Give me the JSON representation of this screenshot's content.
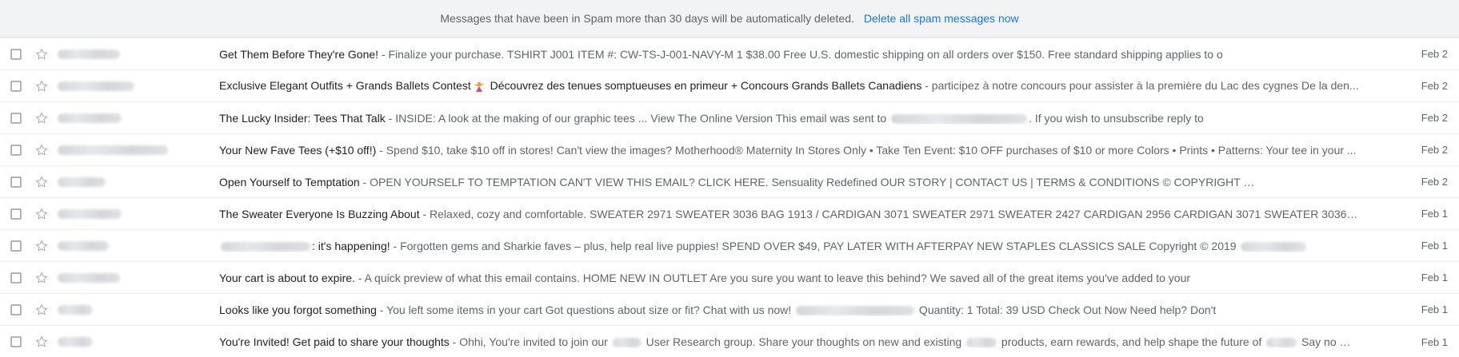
{
  "banner": {
    "message": "Messages that have been in Spam more than 30 days will be automatically deleted.",
    "action": "Delete all spam messages now"
  },
  "emails": [
    {
      "sender_blur_width": 78,
      "subject": "Get Them Before They're Gone!",
      "snippet_parts": [
        " - Finalize your purchase. TSHIRT J001 ITEM #: CW-TS-J-001-NAVY-M 1 $38.00 Free U.S. domestic shipping on all orders over $150. Free standard shipping applies to o"
      ],
      "date": "Feb 2"
    },
    {
      "sender_blur_width": 96,
      "subject": "Exclusive Elegant Outfits + Grands Ballets Contest",
      "emoji": "dancer-emoji",
      "subject_tail": " Découvrez des tenues somptueuses en primeur + Concours Grands Ballets Canadiens",
      "snippet_parts": [
        " - participez à notre concours pour assister à la première du Lac des cygnes De la den..."
      ],
      "date": "Feb 2"
    },
    {
      "sender_blur_width": 80,
      "subject": "The Lucky Insider: Tees That Talk",
      "snippet_parts": [
        " - INSIDE: A look at the making of our graphic tees ... View The Online Version This email was sent to ",
        "",
        ". If you wish to unsubscribe reply to"
      ],
      "snippet_blur_widths": [
        170
      ],
      "date": "Feb 2"
    },
    {
      "sender_blur_width": 138,
      "subject": "Your New Fave Tees (+$10 off!)",
      "snippet_parts": [
        " - Spend $10, take $10 off in stores! Can't view the images? Motherhood® Maternity In Stores Only • Take Ten Event: $10 OFF purchases of $10 or more Colors • Prints • Patterns: Your tee in your ..."
      ],
      "date": "Feb 2"
    },
    {
      "sender_blur_width": 60,
      "subject": "Open Yourself to Temptation",
      "snippet_parts": [
        " - OPEN YOURSELF TO TEMPTATION CAN'T VIEW THIS EMAIL? CLICK HERE. Sensuality Redefined OUR STORY | CONTACT US | TERMS & CONDITIONS © COPYRIGHT ",
        ""
      ],
      "snippet_blur_widths": [
        150
      ],
      "date": "Feb 2"
    },
    {
      "sender_blur_width": 80,
      "subject": "The Sweater Everyone Is Buzzing About",
      "snippet_parts": [
        " - Relaxed, cozy and comfortable. SWEATER 2971 SWEATER 3036 BAG 1913 / CARDIGAN 3071 SWEATER 2971 SWEATER 2427 CARDIGAN 2956 CARDIGAN 3071 SWEATER 3036 CARDI..."
      ],
      "date": "Feb 1"
    },
    {
      "sender_blur_width": 64,
      "subject_prefix_blur": 112,
      "subject": ": it's happening!",
      "snippet_parts": [
        " - Forgotten gems and Sharkie faves – plus, help real live puppies! SPEND OVER $49, PAY LATER WITH AFTERPAY NEW STAPLES CLASSICS SALE Copyright © 2019 ",
        ""
      ],
      "snippet_blur_widths": [
        82
      ],
      "date": "Feb 1"
    },
    {
      "sender_blur_width": 78,
      "subject": "Your cart is about to expire.",
      "snippet_parts": [
        " - A quick preview of what this email contains. HOME NEW IN OUTLET Are you sure you want to leave this behind? We saved all of the great items you've added to your"
      ],
      "date": "Feb 1"
    },
    {
      "sender_blur_width": 44,
      "subject": "Looks like you forgot something",
      "snippet_parts": [
        " - You left some items in your cart Got questions about size or fit? Chat with us now! ",
        "",
        " Quantity: 1 Total: 39 USD Check Out Now Need help? Don't"
      ],
      "snippet_blur_widths": [
        148
      ],
      "date": "Feb 1"
    },
    {
      "sender_blur_width": 44,
      "subject": "You're Invited! Get paid to share your thoughts",
      "snippet_parts": [
        " - Ohhi, You're invited to join our ",
        "",
        " User Research group. Share your thoughts on new and existing ",
        "",
        " products, earn rewards, and help shape the future of ",
        "",
        " Say no mo..."
      ],
      "snippet_blur_widths": [
        36,
        38,
        38
      ],
      "date": "Feb 1"
    }
  ],
  "colors": {
    "banner_bg": "#f1f3f4",
    "link": "#1a73e8",
    "subject": "#202124",
    "snippet": "#5f6368"
  },
  "icons": {
    "checkbox": "checkbox-icon",
    "star": "star-outline-icon"
  }
}
